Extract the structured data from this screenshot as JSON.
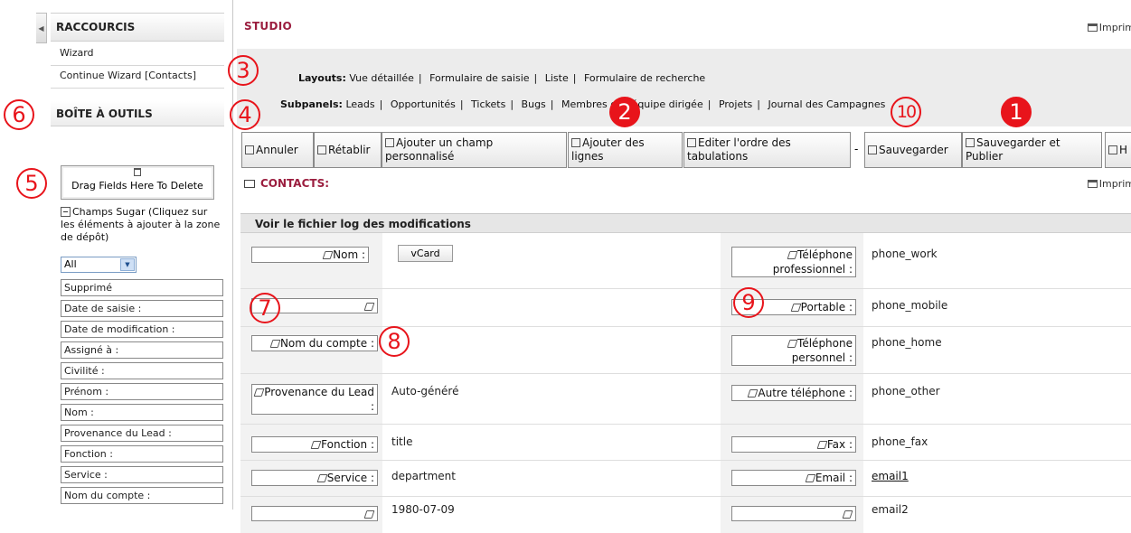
{
  "sidebar": {
    "shortcuts_title": "RACCOURCIS",
    "shortcut_items": [
      "Wizard",
      "Continue Wizard [Contacts]"
    ],
    "toolbox_title": "BOÎTE À OUTILS",
    "delete_zone_label": "Drag Fields Here To Delete",
    "sugar_fields_label": "Champs Sugar (Cliquez sur les éléments à ajouter à la zone de dépôt)",
    "filter_value": "All",
    "fields": [
      "Supprimé",
      "Date de saisie :",
      "Date de modification :",
      "Assigné à :",
      "Civilité :",
      "Prénom :",
      "Nom :",
      "Provenance du Lead :",
      "Fonction :",
      "Service :",
      "Nom du compte :"
    ]
  },
  "studio": {
    "title": "STUDIO",
    "print_label": "Imprim",
    "layouts_label": "Layouts:",
    "layout_links": [
      "Vue détaillée",
      "Formulaire de saisie",
      "Liste",
      "Formulaire de recherche"
    ],
    "subpanels_label": "Subpanels:",
    "subpanel_links": [
      "Leads",
      "Opportunités",
      "Tickets",
      "Bugs",
      "Membres de l'équipe dirigée",
      "Projets",
      "Journal des Campagnes"
    ]
  },
  "toolbar": {
    "cancel": "Annuler",
    "redo": "Rétablir",
    "add_custom_field": "Ajouter un champ personnalisé",
    "add_rows": "Ajouter des lignes",
    "edit_tab_order": "Editer l'ordre des tabulations",
    "dash": "-",
    "save": "Sauvegarder",
    "save_publish": "Sauvegarder et Publier",
    "partial": "H"
  },
  "contacts": {
    "title": "CONTACTS:",
    "print_label": "Imprim",
    "log_link": "Voir le fichier log des modifications",
    "vcard_label": "vCard",
    "rows": [
      {
        "left_label": "Nom :",
        "right_label": "Téléphone professionnel :",
        "right_value": "phone_work"
      },
      {
        "left_label": "",
        "right_label": "Portable :",
        "right_value": "phone_mobile"
      },
      {
        "left_label": "Nom du compte :",
        "right_label": "Téléphone personnel :",
        "right_value": "phone_home"
      },
      {
        "left_label": "Provenance du Lead :",
        "left_value": "Auto-généré",
        "right_label": "Autre téléphone :",
        "right_value": "phone_other"
      },
      {
        "left_label": "Fonction :",
        "left_value": "title",
        "right_label": "Fax :",
        "right_value": "phone_fax"
      },
      {
        "left_label": "Service :",
        "left_value": "department",
        "right_label": "Email :",
        "right_value": "email1"
      },
      {
        "left_value": "1980-07-09",
        "right_value": "email2"
      }
    ]
  },
  "markers": [
    "3",
    "6",
    "4",
    "2",
    "10",
    "1",
    "5",
    "7",
    "9",
    "8"
  ],
  "colors": {
    "marker_red": "#e8141b",
    "title_red": "#9b1e3f"
  }
}
